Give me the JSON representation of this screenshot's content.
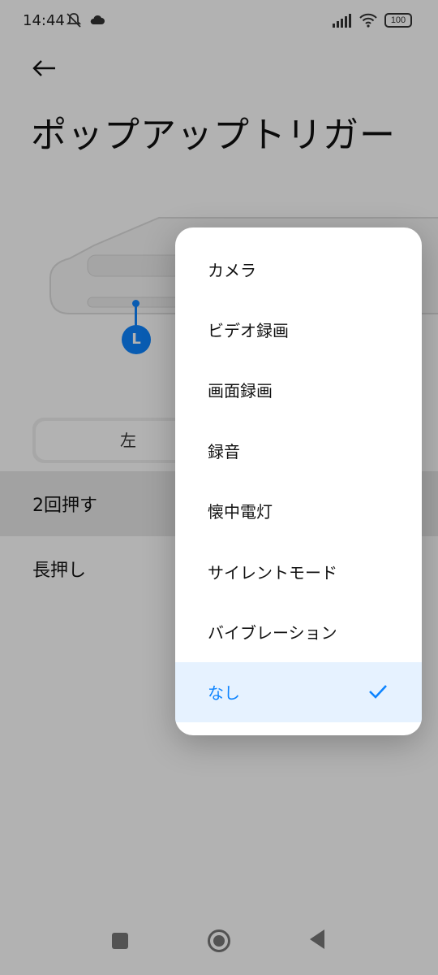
{
  "status": {
    "time": "14:44",
    "battery": "100"
  },
  "header": {
    "title": "ポップアップトリガー"
  },
  "illustration": {
    "marker_label": "L"
  },
  "segment": {
    "left_label": "左"
  },
  "settings": {
    "rows": [
      {
        "label": "2回押す"
      },
      {
        "label": "長押し"
      }
    ]
  },
  "menu": {
    "items": [
      {
        "label": "カメラ"
      },
      {
        "label": "ビデオ録画"
      },
      {
        "label": "画面録画"
      },
      {
        "label": "録音"
      },
      {
        "label": "懐中電灯"
      },
      {
        "label": "サイレントモード"
      },
      {
        "label": "バイブレーション"
      },
      {
        "label": "なし"
      }
    ],
    "selected_index": 7
  },
  "colors": {
    "accent": "#0d84ff",
    "selected_bg": "#e6f2ff"
  }
}
